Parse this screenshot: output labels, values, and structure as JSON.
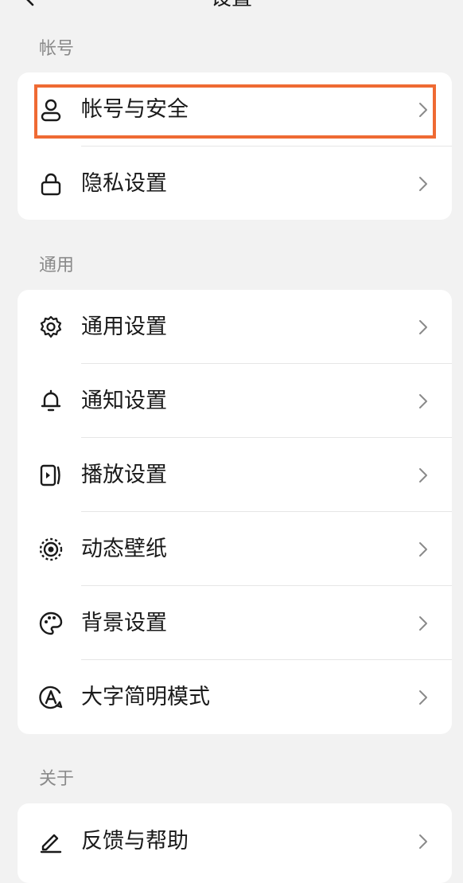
{
  "header": {
    "title": "设置",
    "back_icon": "chevron-left-icon"
  },
  "sections": [
    {
      "title": "帐号",
      "items": [
        {
          "label": "帐号与安全",
          "icon": "person-icon"
        },
        {
          "label": "隐私设置",
          "icon": "lock-icon"
        }
      ]
    },
    {
      "title": "通用",
      "items": [
        {
          "label": "通用设置",
          "icon": "gear-icon"
        },
        {
          "label": "通知设置",
          "icon": "bell-icon"
        },
        {
          "label": "播放设置",
          "icon": "play-icon"
        },
        {
          "label": "动态壁纸",
          "icon": "live-wallpaper-icon"
        },
        {
          "label": "背景设置",
          "icon": "palette-icon"
        },
        {
          "label": "大字简明模式",
          "icon": "large-text-icon"
        }
      ]
    },
    {
      "title": "关于",
      "items": [
        {
          "label": "反馈与帮助",
          "icon": "pencil-icon"
        }
      ]
    }
  ],
  "highlight_color": "#ef6a33",
  "chevron_icon": "chevron-right-icon"
}
